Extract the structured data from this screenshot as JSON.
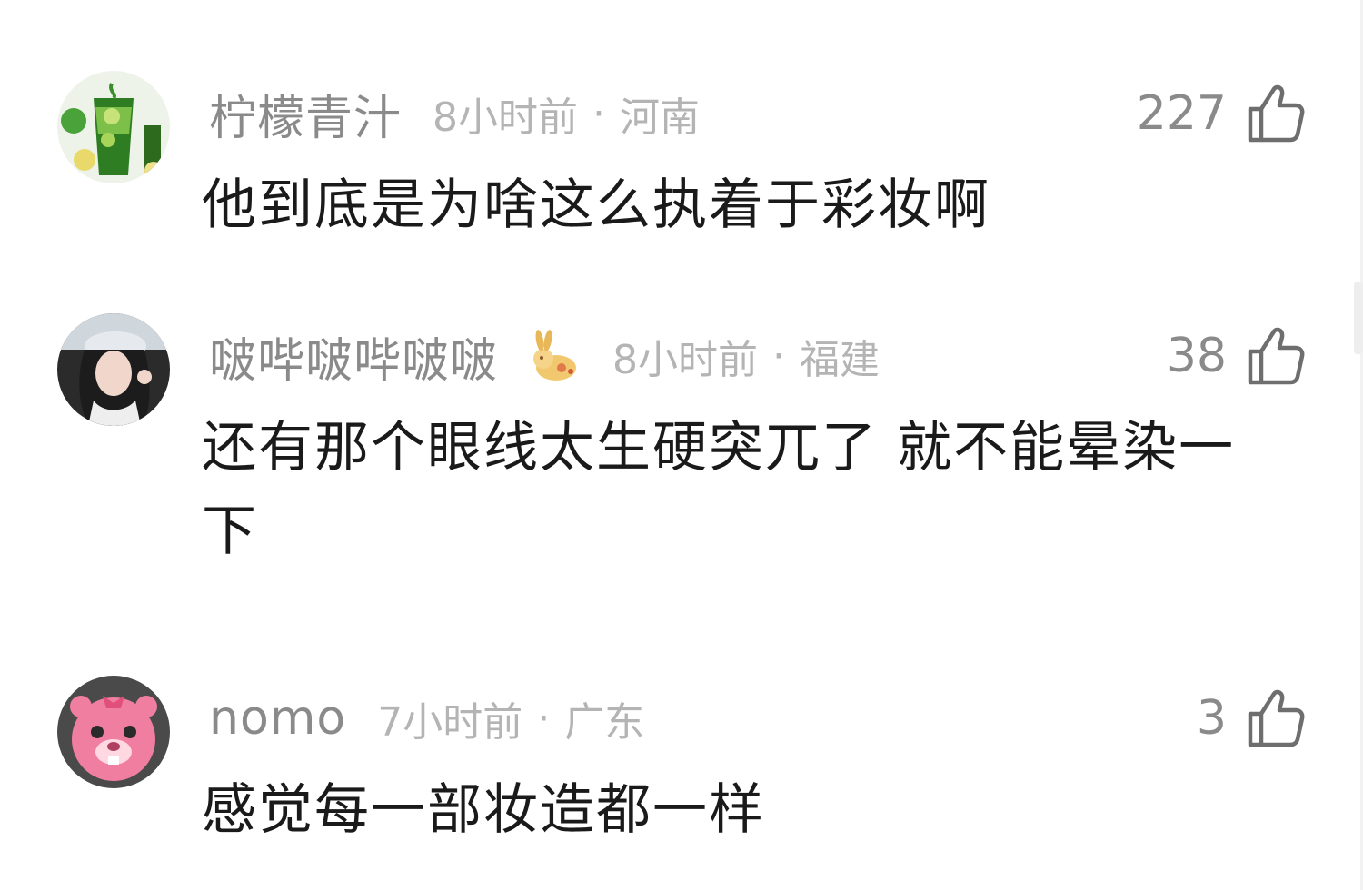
{
  "comments": [
    {
      "username": "柠檬青汁",
      "time": "8小时前",
      "separator": "·",
      "region": "河南",
      "likes": "227",
      "text": "他到底是为啥这么执着于彩妆啊",
      "avatar_icon": "green-juice-avatar"
    },
    {
      "username": "啵哔啵哔啵啵",
      "badge_icon": "golden-rabbit-badge",
      "time": "8小时前",
      "separator": "·",
      "region": "福建",
      "likes": "38",
      "text": "还有那个眼线太生硬突兀了 就不能晕染一下",
      "avatar_icon": "girl-photo-avatar"
    },
    {
      "username": "nomo",
      "time": "7小时前",
      "separator": "·",
      "region": "广东",
      "likes": "3",
      "text": "感觉每一部妆造都一样",
      "avatar_icon": "pink-beaver-avatar"
    }
  ],
  "like_icon": "thumbs-up-icon"
}
